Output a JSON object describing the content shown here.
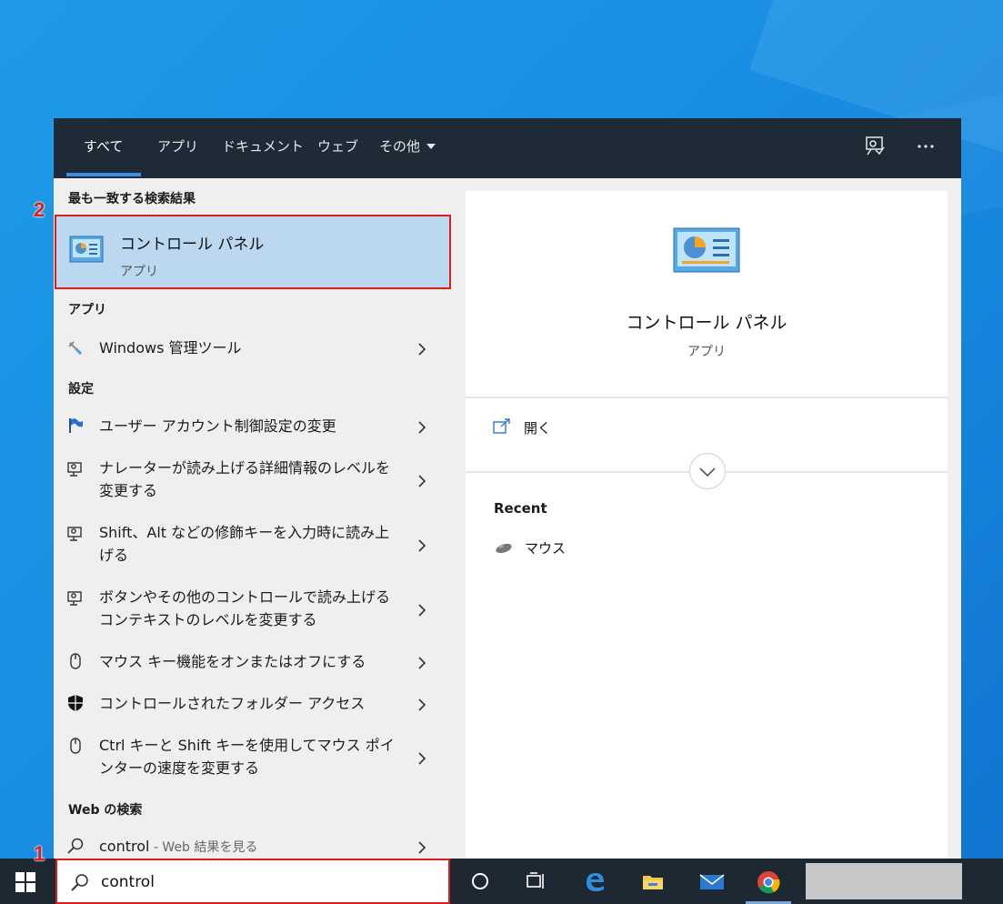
{
  "tabs": [
    {
      "label": "すべて"
    },
    {
      "label": "アプリ"
    },
    {
      "label": "ドキュメント"
    },
    {
      "label": "ウェブ"
    },
    {
      "label": "その他"
    }
  ],
  "icons": {
    "feedback": "feedback-icon",
    "more": "more-options-icon"
  },
  "best_match": {
    "heading": "最も一致する検索結果",
    "title": "コントロール パネル",
    "subtitle": "アプリ"
  },
  "apps": {
    "heading": "アプリ",
    "items": [
      {
        "label": "Windows 管理ツール",
        "icon": "admin-tools-icon"
      }
    ]
  },
  "settings": {
    "heading": "設定",
    "items": [
      {
        "label": "ユーザー アカウント制御設定の変更",
        "icon": "flag-icon"
      },
      {
        "label": "ナレーターが読み上げる詳細情報のレベルを変更する",
        "icon": "narrator-icon"
      },
      {
        "label": "Shift、Alt などの修飾キーを入力時に読み上げる",
        "icon": "narrator-icon"
      },
      {
        "label": "ボタンやその他のコントロールで読み上げるコンテキストのレベルを変更する",
        "icon": "narrator-icon"
      },
      {
        "label": "マウス キー機能をオンまたはオフにする",
        "icon": "mouse-icon"
      },
      {
        "label": "コントロールされたフォルダー アクセス",
        "icon": "shield-icon"
      },
      {
        "label": "Ctrl キーと Shift キーを使用してマウス ポインターの速度を変更する",
        "icon": "mouse-icon"
      }
    ]
  },
  "web": {
    "heading": "Web の検索",
    "query": "control",
    "suffix": " - Web 結果を見る"
  },
  "preview": {
    "title": "コントロール パネル",
    "subtitle": "アプリ",
    "open_label": "開く",
    "recent_heading": "Recent",
    "recent_items": [
      {
        "label": "マウス",
        "icon": "mouse-device-icon"
      }
    ]
  },
  "search": {
    "value": "control"
  },
  "taskbar": {
    "icons": [
      "cortana-icon",
      "task-view-icon",
      "edge-icon",
      "file-explorer-icon",
      "mail-icon",
      "chrome-icon"
    ]
  },
  "annotations": {
    "step1": "1",
    "step2": "2"
  },
  "colors": {
    "accent": "#3b8ee0",
    "highlight": "#bcd7f0",
    "annotation": "#e01b1b",
    "topbar": "#1f2a37",
    "taskbar": "#1e2833"
  }
}
